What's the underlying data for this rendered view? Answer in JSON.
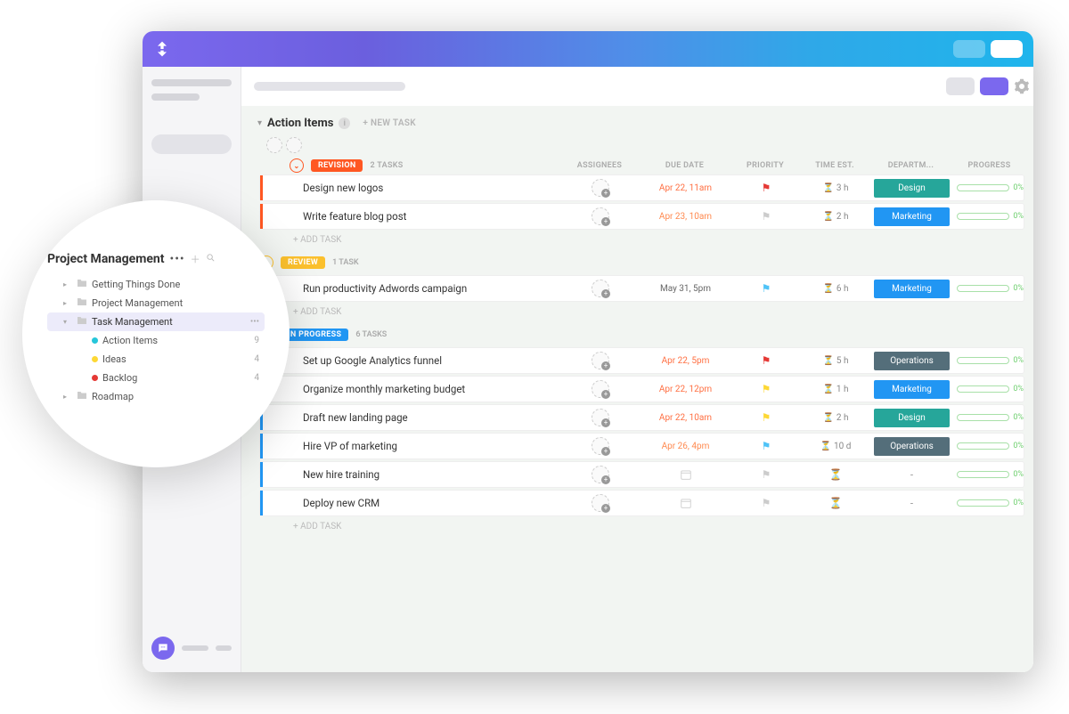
{
  "list": {
    "title": "Action Items",
    "new_task": "+ NEW TASK"
  },
  "columns": {
    "assignees": "ASSIGNEES",
    "due": "DUE DATE",
    "priority": "PRIORITY",
    "time": "TIME EST.",
    "dept": "DEPARTM...",
    "progress": "PROGRESS"
  },
  "add_task": "+ ADD TASK",
  "statuses": [
    {
      "name": "REVISION",
      "color": "#FF5722",
      "count": "2 TASKS",
      "tasks": [
        {
          "name": "Design new logos",
          "due": "Apr 22, 11am",
          "dueColor": "#FF7043",
          "flagColor": "#E53935",
          "time": "3 h",
          "dept": "Design",
          "deptColor": "#26A69A",
          "prog": "0%"
        },
        {
          "name": "Write feature blog post",
          "due": "Apr 23, 10am",
          "dueColor": "#FF8A50",
          "flagColor": "#ccc",
          "time": "2 h",
          "dept": "Marketing",
          "deptColor": "#2196F3",
          "prog": "0%"
        }
      ]
    },
    {
      "name": "REVIEW",
      "color": "#FBC02D",
      "count": "1 TASK",
      "tasks": [
        {
          "name": "Run productivity Adwords campaign",
          "due": "May 31, 5pm",
          "dueColor": "#666",
          "flagColor": "#4FC3F7",
          "time": "6 h",
          "dept": "Marketing",
          "deptColor": "#2196F3",
          "prog": "0%"
        }
      ]
    },
    {
      "name": "IN PROGRESS",
      "color": "#2196F3",
      "count": "6 TASKS",
      "tasks": [
        {
          "name": "Set up Google Analytics funnel",
          "due": "Apr 22, 5pm",
          "dueColor": "#FF7043",
          "flagColor": "#E53935",
          "time": "5 h",
          "dept": "Operations",
          "deptColor": "#546E7A",
          "prog": "0%"
        },
        {
          "name": "Organize monthly marketing budget",
          "due": "Apr 22, 12pm",
          "dueColor": "#FF7043",
          "flagColor": "#FDD835",
          "time": "1 h",
          "dept": "Marketing",
          "deptColor": "#2196F3",
          "prog": "0%"
        },
        {
          "name": "Draft new landing page",
          "due": "Apr 22, 10am",
          "dueColor": "#FF7043",
          "flagColor": "#FDD835",
          "time": "2 h",
          "dept": "Design",
          "deptColor": "#26A69A",
          "prog": "0%"
        },
        {
          "name": "Hire VP of marketing",
          "due": "Apr 26, 4pm",
          "dueColor": "#FF8A50",
          "flagColor": "#4FC3F7",
          "time": "10 d",
          "dept": "Operations",
          "deptColor": "#546E7A",
          "prog": "0%"
        },
        {
          "name": "New hire training",
          "due": "",
          "dueColor": "",
          "flagColor": "",
          "time": "",
          "dept": "-",
          "deptColor": "",
          "prog": "0%"
        },
        {
          "name": "Deploy new CRM",
          "due": "",
          "dueColor": "",
          "flagColor": "",
          "time": "",
          "dept": "-",
          "deptColor": "",
          "prog": "0%"
        }
      ]
    }
  ],
  "popover": {
    "title": "Project Management",
    "items": [
      {
        "type": "folder",
        "label": "Getting Things Done",
        "arrow": "▸"
      },
      {
        "type": "folder",
        "label": "Project Management",
        "arrow": "▸"
      },
      {
        "type": "folder",
        "label": "Task Management",
        "arrow": "▾",
        "active": true,
        "more": true
      },
      {
        "type": "list",
        "label": "Action Items",
        "dot": "#26C6DA",
        "count": "9"
      },
      {
        "type": "list",
        "label": "Ideas",
        "dot": "#FDD835",
        "count": "4"
      },
      {
        "type": "list",
        "label": "Backlog",
        "dot": "#E53935",
        "count": "4"
      },
      {
        "type": "folder",
        "label": "Roadmap",
        "arrow": "▸"
      }
    ]
  }
}
